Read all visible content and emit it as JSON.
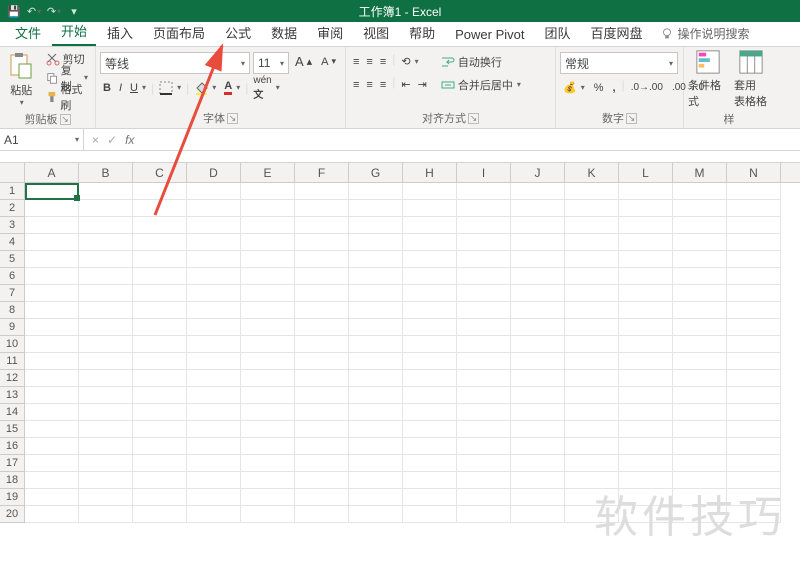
{
  "title": "工作簿1 - Excel",
  "qat": {
    "save": "💾"
  },
  "tabs": {
    "file": "文件",
    "home": "开始",
    "insert": "插入",
    "layout": "页面布局",
    "formula": "公式",
    "data": "数据",
    "review": "审阅",
    "view": "视图",
    "help": "帮助",
    "powerpivot": "Power Pivot",
    "team": "团队",
    "baidu": "百度网盘",
    "tellme": "操作说明搜索"
  },
  "clip": {
    "cut": "剪切",
    "copy": "复制",
    "brush": "格式刷",
    "paste": "粘贴",
    "label": "剪贴板"
  },
  "font": {
    "name": "等线",
    "size": "11",
    "label": "字体"
  },
  "align": {
    "wrap": "自动换行",
    "merge": "合并后居中",
    "label": "对齐方式"
  },
  "number": {
    "format": "常规",
    "label": "数字"
  },
  "styles": {
    "cond": "条件格式",
    "table": "套用\n表格格"
  },
  "namebox": "A1",
  "cols": [
    "A",
    "B",
    "C",
    "D",
    "E",
    "F",
    "G",
    "H",
    "I",
    "J",
    "K",
    "L",
    "M",
    "N"
  ],
  "rows": [
    "1",
    "2",
    "3",
    "4",
    "5",
    "6",
    "7",
    "8",
    "9",
    "10",
    "11",
    "12",
    "13",
    "14",
    "15",
    "16",
    "17",
    "18",
    "19",
    "20"
  ],
  "watermark": "软件技巧"
}
